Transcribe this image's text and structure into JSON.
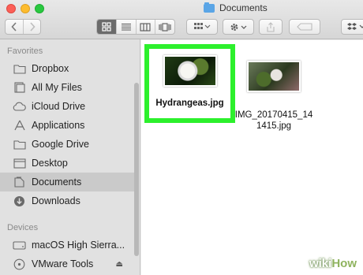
{
  "window": {
    "title": "Documents",
    "colors": {
      "close": "#fc5f57",
      "minimize": "#fdbc2e",
      "zoom": "#29c840"
    }
  },
  "toolbar": {
    "back_icon": "chevron-left-icon",
    "forward_icon": "chevron-right-icon",
    "view_modes": [
      "icon-view",
      "list-view",
      "column-view",
      "cover-flow-view"
    ],
    "active_view": "icon-view"
  },
  "sidebar": {
    "sections": [
      {
        "header": "Favorites",
        "items": [
          {
            "label": "Dropbox",
            "icon": "folder-icon",
            "selected": false
          },
          {
            "label": "All My Files",
            "icon": "all-files-icon",
            "selected": false
          },
          {
            "label": "iCloud Drive",
            "icon": "cloud-icon",
            "selected": false
          },
          {
            "label": "Applications",
            "icon": "applications-icon",
            "selected": false
          },
          {
            "label": "Google Drive",
            "icon": "folder-icon",
            "selected": false
          },
          {
            "label": "Desktop",
            "icon": "desktop-icon",
            "selected": false
          },
          {
            "label": "Documents",
            "icon": "documents-icon",
            "selected": true
          },
          {
            "label": "Downloads",
            "icon": "downloads-icon",
            "selected": false
          }
        ]
      },
      {
        "header": "Devices",
        "items": [
          {
            "label": "macOS High Sierra...",
            "icon": "hard-drive-icon",
            "selected": false
          },
          {
            "label": "VMware Tools",
            "icon": "disc-icon",
            "selected": false,
            "eject": true
          }
        ]
      }
    ]
  },
  "files": [
    {
      "name": "Hydrangeas.jpg",
      "highlighted": true,
      "highlight_color": "#2cf02c"
    },
    {
      "name_line1": "IMG_20170415_14",
      "name_line2": "1415.jpg",
      "highlighted": false
    }
  ],
  "watermark": {
    "part1": "wiki",
    "part2": "How"
  }
}
